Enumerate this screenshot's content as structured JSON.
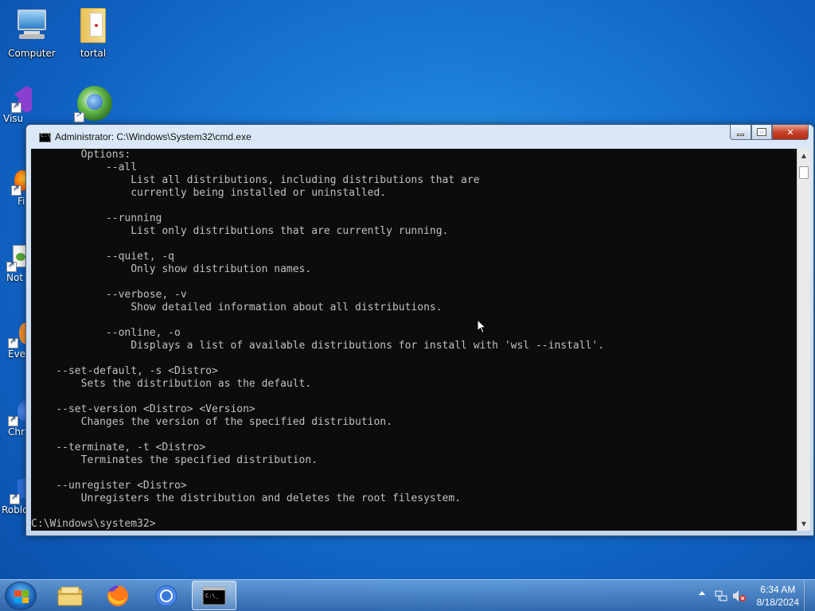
{
  "desktop": {
    "icons": [
      {
        "label": "Computer"
      },
      {
        "label": "tortal"
      }
    ],
    "partial_labels": [
      "Visu",
      "Fi",
      "Not",
      "Eve",
      "Chr",
      "Roblo"
    ]
  },
  "window": {
    "title": "Administrator: C:\\Windows\\System32\\cmd.exe",
    "icon_text": "C:\\",
    "console_lines": [
      "        Options:",
      "            --all",
      "                List all distributions, including distributions that are",
      "                currently being installed or uninstalled.",
      "",
      "            --running",
      "                List only distributions that are currently running.",
      "",
      "            --quiet, -q",
      "                Only show distribution names.",
      "",
      "            --verbose, -v",
      "                Show detailed information about all distributions.",
      "",
      "            --online, -o",
      "                Displays a list of available distributions for install with 'wsl --install'.",
      "",
      "    --set-default, -s <Distro>",
      "        Sets the distribution as the default.",
      "",
      "    --set-version <Distro> <Version>",
      "        Changes the version of the specified distribution.",
      "",
      "    --terminate, -t <Distro>",
      "        Terminates the specified distribution.",
      "",
      "    --unregister <Distro>",
      "        Unregisters the distribution and deletes the root filesystem.",
      "",
      "C:\\Windows\\system32>"
    ]
  },
  "taskbar": {
    "clock_time": "6:34 AM",
    "clock_date": "8/18/2024",
    "pinned": [
      "explorer-icon",
      "firefox-icon",
      "chrome-icon",
      "cmd-icon"
    ]
  },
  "colors": {
    "console_bg": "#0c0c0c",
    "console_fg": "#c0c0c0",
    "desktop_accent": "#1a7ad6"
  }
}
